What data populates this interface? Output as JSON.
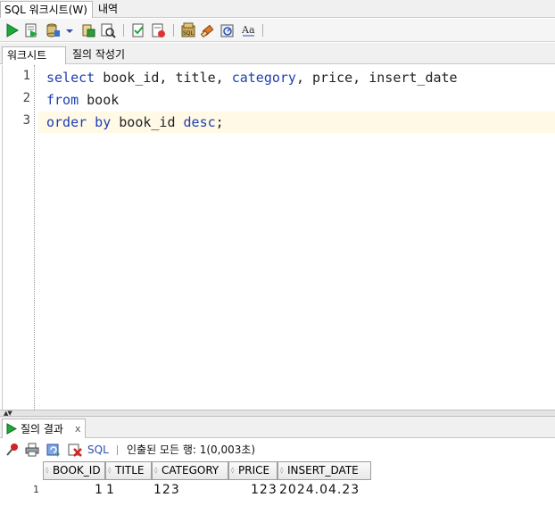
{
  "top_tabs": {
    "worksheet_tab": "SQL 워크시트(W)",
    "history_tab": "내역"
  },
  "sub_tabs": {
    "worksheet": "워크시트",
    "query_builder": "질의 작성기"
  },
  "toolbar": {
    "icons": [
      "run-statement-icon",
      "run-script-icon",
      "commit-icon",
      "dropdown-icon",
      "rollback-icon",
      "explain-plan-icon",
      "autotrace-icon",
      "sql-tuning-icon",
      "clear-icon",
      "sql-history-icon",
      "format-icon"
    ]
  },
  "editor": {
    "lines": [
      {
        "number": "1",
        "tokens": [
          {
            "t": "select",
            "kw": true
          },
          {
            "t": " book_id, title, ",
            "kw": false
          },
          {
            "t": "category",
            "kw": true
          },
          {
            "t": ", price, insert_date",
            "kw": false
          }
        ]
      },
      {
        "number": "2",
        "tokens": [
          {
            "t": "from",
            "kw": true
          },
          {
            "t": " book",
            "kw": false
          }
        ]
      },
      {
        "number": "3",
        "tokens": [
          {
            "t": "order by",
            "kw": true
          },
          {
            "t": " book_id ",
            "kw": false
          },
          {
            "t": "desc",
            "kw": true
          },
          {
            "t": ";",
            "kw": false
          }
        ]
      }
    ],
    "current_line": 3
  },
  "result": {
    "tab_label": "질의 결과",
    "close_label": "x",
    "sql_label": "SQL",
    "status": "인출된 모든 행: 1(0,003초)",
    "columns": [
      "BOOK_ID",
      "TITLE",
      "CATEGORY",
      "PRICE",
      "INSERT_DATE"
    ],
    "rows": [
      {
        "row_number": "1",
        "cells": [
          "1",
          "1",
          "123",
          "123",
          "2024.04.23"
        ]
      }
    ]
  },
  "colors": {
    "keyword": "#1c3fb0",
    "current_line": "#fff9e6",
    "run_green": "#1fa83a"
  }
}
